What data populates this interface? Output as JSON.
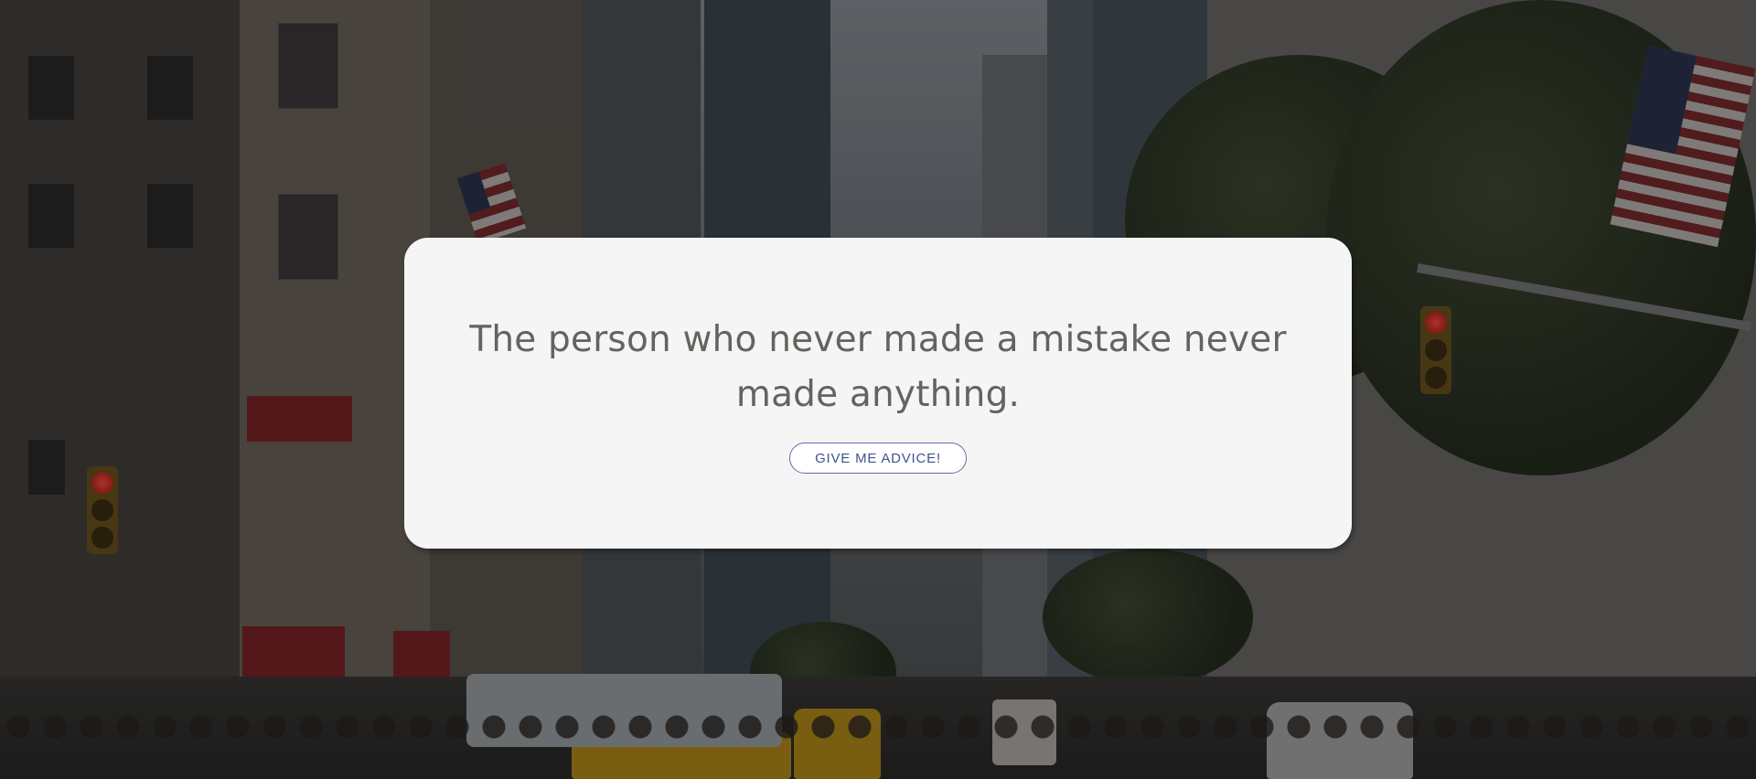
{
  "background": {
    "description_icon": "city-street-photo",
    "overlay_color": "#000000"
  },
  "card": {
    "quote": "The person who never made a mistake never made anything.",
    "button_label": "GIVE ME ADVICE!",
    "background_color": "#f5f5f5",
    "text_color": "#66625f",
    "button_color": "#3e548f"
  }
}
